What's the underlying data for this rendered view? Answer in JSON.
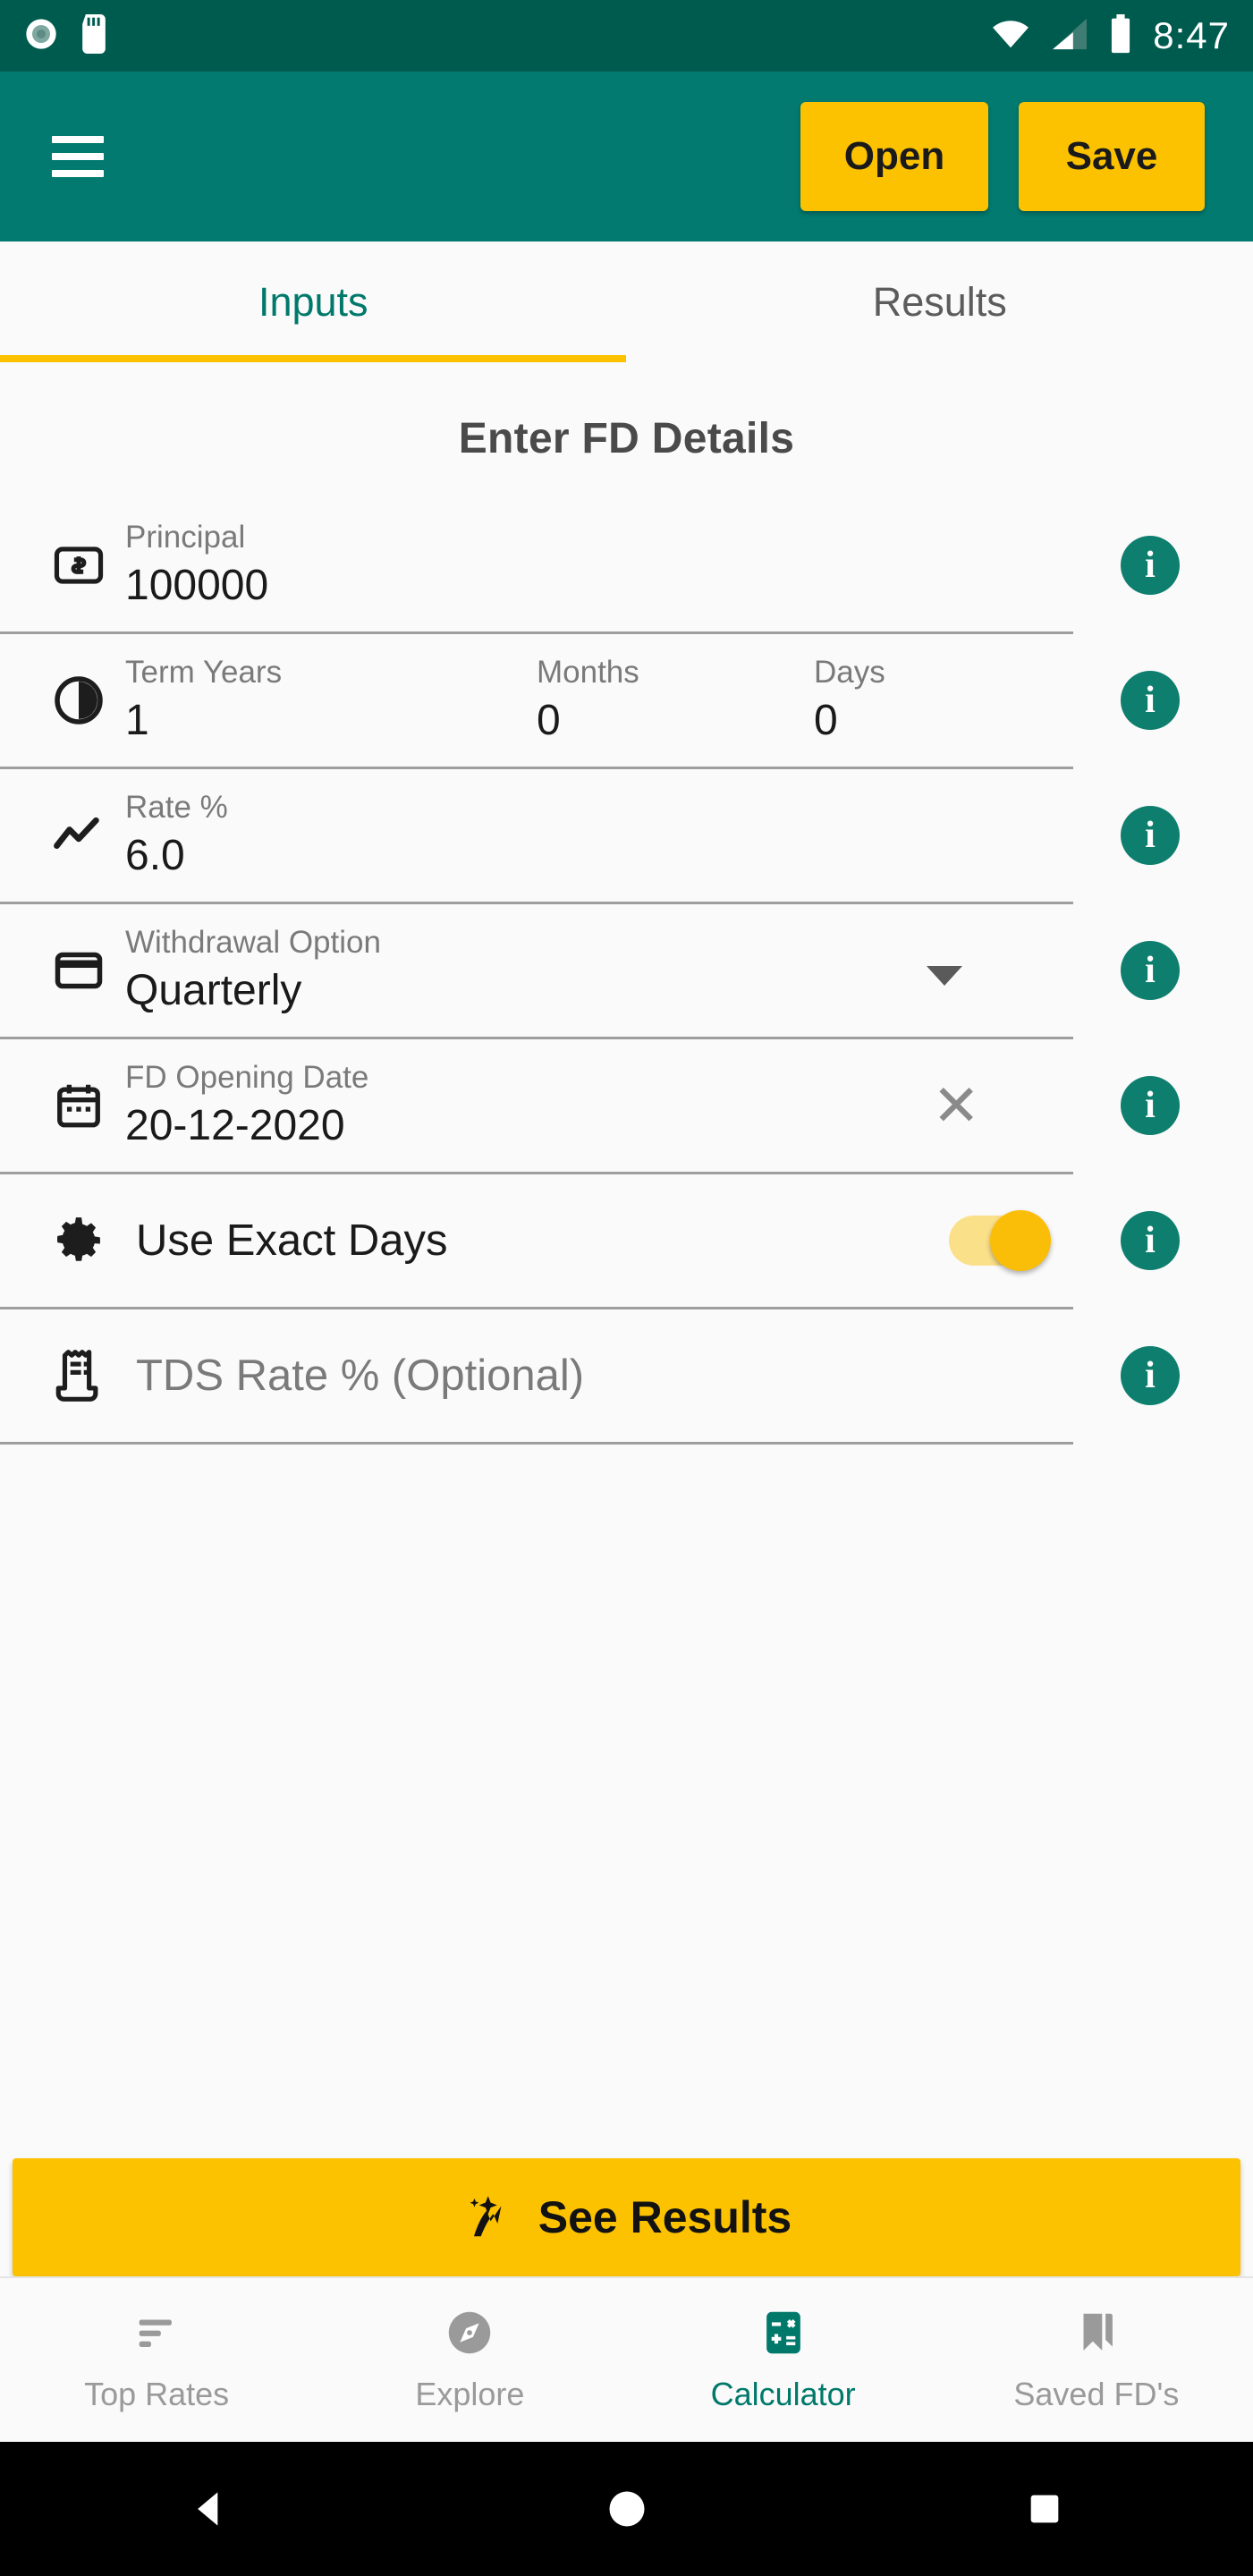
{
  "status_bar": {
    "time": "8:47",
    "icons": [
      "record-circle-icon",
      "sd-card-icon",
      "wifi-icon",
      "cellular-signal-icon",
      "battery-icon"
    ]
  },
  "app_bar": {
    "menu_icon": "hamburger-menu-icon",
    "open_label": "Open",
    "save_label": "Save",
    "background_color": "#027A6F"
  },
  "tabs": {
    "items": [
      {
        "label": "Inputs",
        "active": true
      },
      {
        "label": "Results",
        "active": false
      }
    ],
    "indicator_color": "#FCC200",
    "active_color": "#00796B"
  },
  "form": {
    "title": "Enter FD Details",
    "info_icon": "info-icon",
    "rows": {
      "principal": {
        "icon": "money-note-icon",
        "label": "Principal",
        "value": "100000"
      },
      "term": {
        "icon": "clock-half-icon",
        "years_label": "Term Years",
        "years_value": "1",
        "months_label": "Months",
        "months_value": "0",
        "days_label": "Days",
        "days_value": "0"
      },
      "rate": {
        "icon": "trend-line-icon",
        "label": "Rate %",
        "value": "6.0"
      },
      "withdrawal": {
        "icon": "credit-card-icon",
        "label": "Withdrawal Option",
        "value": "Quarterly",
        "dropdown_icon": "chevron-down-icon"
      },
      "opening_date": {
        "icon": "calendar-icon",
        "label": "FD Opening Date",
        "value": "20-12-2020",
        "clear_icon": "close-icon"
      },
      "exact_days": {
        "icon": "gear-icon",
        "label": "Use Exact Days",
        "toggle_on": true,
        "toggle_color": "#FBBE08"
      },
      "tds": {
        "icon": "receipt-icon",
        "placeholder": "TDS Rate % (Optional)"
      }
    }
  },
  "primary_action": {
    "label": "See Results",
    "icon": "sparkle-trend-icon",
    "color": "#FCC200"
  },
  "bottom_nav": {
    "items": [
      {
        "label": "Top Rates",
        "icon": "bars-list-icon",
        "active": false
      },
      {
        "label": "Explore",
        "icon": "compass-icon",
        "active": false
      },
      {
        "label": "Calculator",
        "icon": "calculator-icon",
        "active": true
      },
      {
        "label": "Saved FD's",
        "icon": "bookmark-icon",
        "active": false
      }
    ],
    "active_color": "#00796B",
    "inactive_color": "#9A9A9A"
  },
  "android_nav": {
    "back_icon": "back-triangle-icon",
    "home_icon": "home-circle-icon",
    "recents_icon": "recents-square-icon"
  }
}
